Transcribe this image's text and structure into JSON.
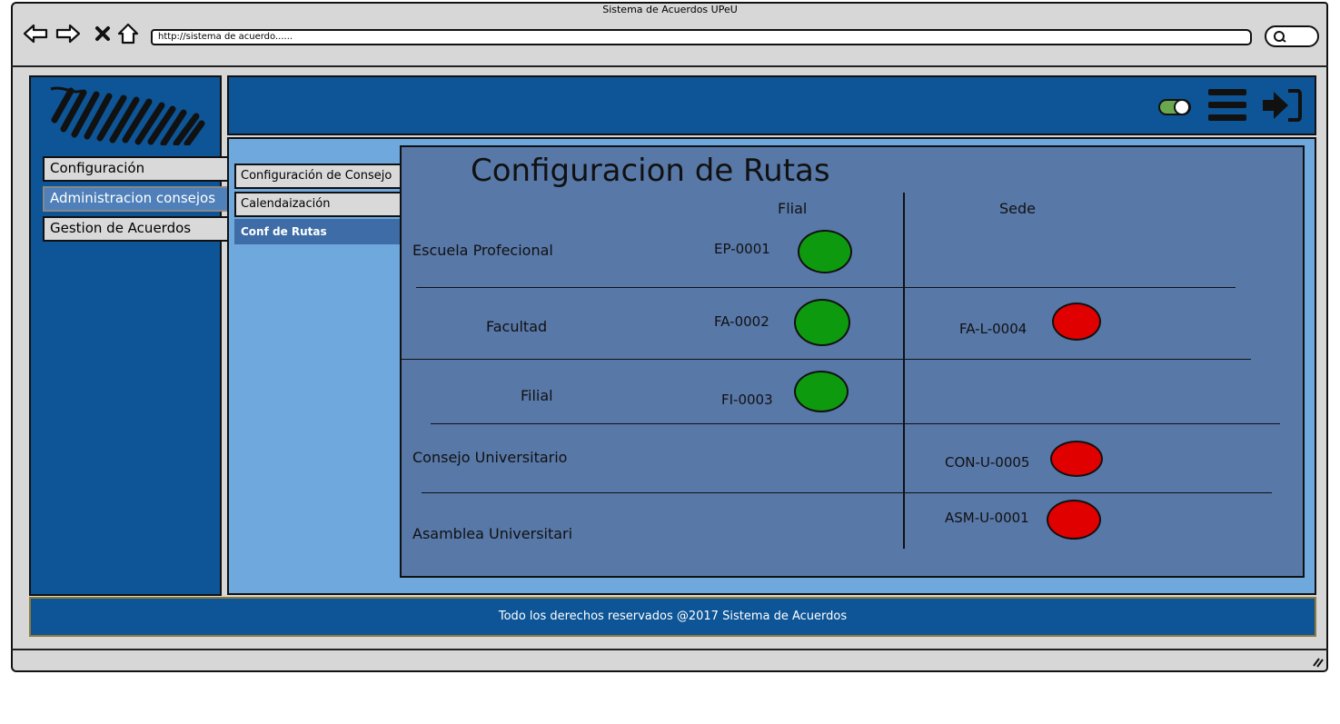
{
  "window": {
    "title": "Sistema de Acuerdos UPeU"
  },
  "browser": {
    "url": "http://sistema de acuerdo......",
    "nav_icons": [
      "back-arrow-icon",
      "forward-arrow-icon",
      "close-x-icon",
      "home-icon"
    ],
    "search_icon": "search-icon"
  },
  "sidebar": {
    "items": [
      {
        "label": "Configuración",
        "active": false
      },
      {
        "label": "Administracion consejos",
        "active": true
      },
      {
        "label": "Gestion de Acuerdos",
        "active": false
      }
    ]
  },
  "header": {
    "icons": [
      "toggle-switch-icon",
      "hamburger-menu-icon",
      "sign-in-arrow-icon"
    ]
  },
  "submenu": {
    "items": [
      {
        "label": "Configuración de Consejo",
        "active": false
      },
      {
        "label": "Calendaización",
        "active": false
      },
      {
        "label": "Conf de Rutas",
        "active": true
      }
    ]
  },
  "panel": {
    "title": "Configuracion de Rutas",
    "columns": {
      "filial": "Flial",
      "sede": "Sede"
    },
    "rows": [
      {
        "label": "Escuela Profecional",
        "filial_code": "EP-0001",
        "filial_status": "green",
        "sede_code": "",
        "sede_status": ""
      },
      {
        "label": "Facultad",
        "filial_code": "FA-0002",
        "filial_status": "green",
        "sede_code": "FA-L-0004",
        "sede_status": "red"
      },
      {
        "label": "Filial",
        "filial_code": "FI-0003",
        "filial_status": "green",
        "sede_code": "",
        "sede_status": ""
      },
      {
        "label": "Consejo Universitario",
        "filial_code": "",
        "filial_status": "",
        "sede_code": "CON-U-0005",
        "sede_status": "red"
      },
      {
        "label": "Asamblea Universitari",
        "filial_code": "",
        "filial_status": "",
        "sede_code": "ASM-U-0001",
        "sede_status": "red"
      }
    ]
  },
  "footer": {
    "text": "Todo los derechos reservados @2017 Sistema de Acuerdos"
  },
  "colors": {
    "nav_blue": "#0d5596",
    "content_blue": "#6fa8dc",
    "panel_blue": "#5878a8",
    "status_green": "#0e9a0e",
    "status_red": "#e00000",
    "toggle_green": "#6aa84f"
  }
}
